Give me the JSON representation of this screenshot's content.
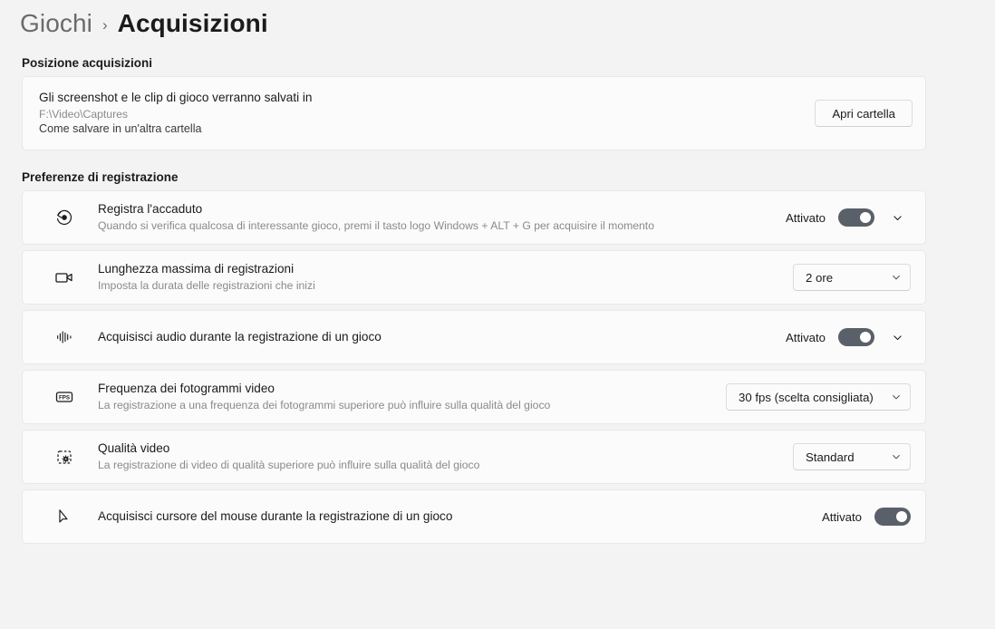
{
  "breadcrumb": {
    "root": "Giochi",
    "separator": "›",
    "current": "Acquisizioni"
  },
  "sections": {
    "location": {
      "label": "Posizione acquisizioni",
      "title": "Gli screenshot e le clip di gioco verranno salvati in",
      "path": "F:\\Video\\Captures",
      "link": "Come salvare in un'altra cartella",
      "button": "Apri cartella"
    },
    "recording": {
      "label": "Preferenze di registrazione"
    }
  },
  "rows": [
    {
      "icon": "record-history-icon",
      "title": "Registra l'accaduto",
      "desc": "Quando si verifica qualcosa di interessante gioco, premi il tasto logo Windows + ALT + G per acquisire il momento",
      "control": "toggle",
      "state": "Attivato",
      "expandable": true
    },
    {
      "icon": "video-camera-icon",
      "title": "Lunghezza massima di registrazioni",
      "desc": "Imposta la durata delle registrazioni che inizi",
      "control": "dropdown",
      "value": "2 ore",
      "expandable": false
    },
    {
      "icon": "audio-waveform-icon",
      "title": "Acquisisci audio durante la registrazione di un gioco",
      "desc": "",
      "control": "toggle",
      "state": "Attivato",
      "expandable": true
    },
    {
      "icon": "fps-badge-icon",
      "title": "Frequenza dei fotogrammi video",
      "desc": "La registrazione a una frequenza dei fotogrammi superiore può influire sulla qualità del gioco",
      "control": "dropdown",
      "value": "30 fps (scelta consigliata)",
      "expandable": false
    },
    {
      "icon": "video-quality-icon",
      "title": "Qualità video",
      "desc": "La registrazione di video di qualità superiore può influire sulla qualità del gioco",
      "control": "dropdown",
      "value": "Standard",
      "expandable": false
    },
    {
      "icon": "mouse-cursor-icon",
      "title": "Acquisisci cursore del mouse durante la registrazione di un gioco",
      "desc": "",
      "control": "toggle",
      "state": "Attivato",
      "expandable": false
    }
  ],
  "colors": {
    "page_background": "#f3f3f3",
    "card_background": "#fbfbfb",
    "card_border": "#e8e8e8",
    "toggle_on": "#5a6069",
    "text_primary": "#1b1b1b",
    "text_secondary": "#8a8a8a"
  }
}
